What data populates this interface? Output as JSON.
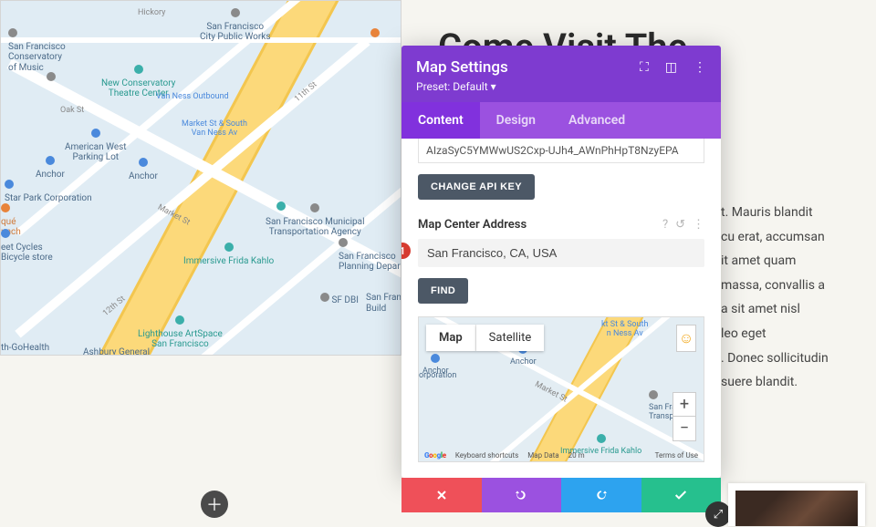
{
  "page": {
    "title_fragment": "Come Visit The",
    "paragraph_fragments": [
      "t. Mauris blandit",
      "cu erat, accumsan",
      "it amet quam",
      "massa, convallis a",
      "a sit amet nisl",
      "leo eget",
      ". Donec sollicitudin",
      "suere blandit."
    ]
  },
  "big_map_poi": {
    "hickory": "Hickory",
    "sf_public_works": "San Francisco\nCity Public Works",
    "sf_conservatory": "San Francisco\nConservatory\nof Music",
    "new_conservatory": "New Conservatory\nTheatre Center",
    "van_ness_outbound": "Van Ness Outbound",
    "oak_st": "Oak St",
    "eleventh": "11th St",
    "market_south_vanness": "Market St & South\nVan Ness Av",
    "aw_parking": "American West\nParking Lot",
    "anchor": "Anchor",
    "anchor2": "Anchor",
    "star_park": "Star Park Corporation",
    "que_lunch": "qué\nunch",
    "eet_cycles": "eet Cycles\nBicycle store",
    "frida": "Immersive Frida Kahlo",
    "sfmta": "San Francisco Municipal\nTransportation Agency",
    "planning": "San Francisco\nPlanning Departm",
    "sf_dbi": "SF DBI",
    "sf_build": "San Francis\nBuild",
    "market_st": "Market St",
    "lighthouse": "Lighthouse ArtSpace\nSan Francisco",
    "twelfth": "12th St",
    "gohealth": "th-GoHealth",
    "ashbury": "Ashbury General"
  },
  "panel": {
    "title": "Map Settings",
    "preset": "Preset: Default ▾",
    "tabs": {
      "content": "Content",
      "design": "Design",
      "advanced": "Advanced"
    },
    "api_key_value": "AIzaSyC5YMWwUS2Cxp-UJh4_AWnPhHpT8NzyEPA",
    "change_api_btn": "CHANGE API KEY",
    "addr_label": "Map Center Address",
    "marker_num": "1",
    "addr_value": "San Francisco, CA, USA",
    "find_btn": "FIND",
    "mini_map": {
      "map_label": "Map",
      "satellite_label": "Satellite",
      "poi_market": "kt St & South\nn Ness Av",
      "poi_anchor": "Anchor",
      "poi_anchor2": "Anchor",
      "poi_corporation": "orporation",
      "poi_market_st": "Market St",
      "poi_frida": "Immersive Frida Kahlo",
      "poi_sf_trans": "San Francisc\nTranspo",
      "attr_shortcuts": "Keyboard shortcuts",
      "attr_mapdata": "Map Data",
      "attr_scale": "20 m",
      "attr_terms": "Terms of Use",
      "zoom_in": "+",
      "zoom_out": "−"
    }
  }
}
